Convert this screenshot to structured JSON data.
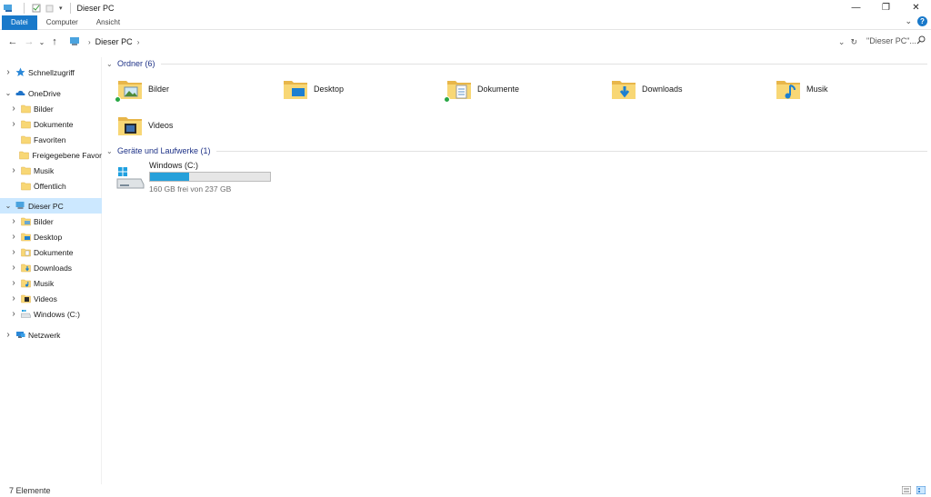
{
  "window": {
    "title": "Dieser PC",
    "controls": {
      "minimize": "—",
      "restore": "❐",
      "close": "✕"
    }
  },
  "ribbon": {
    "tabs": [
      {
        "label": "Datei",
        "active": true
      },
      {
        "label": "Computer",
        "active": false
      },
      {
        "label": "Ansicht",
        "active": false
      }
    ],
    "help": "?"
  },
  "nav": {
    "back": "←",
    "forward": "→",
    "recent": "⌄",
    "up": "↑",
    "address": {
      "location": "Dieser PC"
    },
    "search": {
      "placeholder": "\"Dieser PC\"..."
    }
  },
  "sidebar": {
    "items": [
      {
        "label": "Schnellzugriff",
        "icon": "star-icon",
        "level": 0,
        "expanded": false,
        "selected": false
      },
      {
        "label": "OneDrive",
        "icon": "cloud-icon",
        "level": 0,
        "expanded": true,
        "selected": false
      },
      {
        "label": "Bilder",
        "icon": "folder-icon",
        "level": 1,
        "expanded": false,
        "selected": false
      },
      {
        "label": "Dokumente",
        "icon": "folder-icon",
        "level": 1,
        "expanded": false,
        "selected": false
      },
      {
        "label": "Favoriten",
        "icon": "folder-icon",
        "level": 1,
        "expanded": null,
        "selected": false
      },
      {
        "label": "Freigegebene Favor",
        "icon": "folder-icon",
        "level": 1,
        "expanded": null,
        "selected": false
      },
      {
        "label": "Musik",
        "icon": "folder-icon",
        "level": 1,
        "expanded": false,
        "selected": false
      },
      {
        "label": "Öffentlich",
        "icon": "folder-icon",
        "level": 1,
        "expanded": null,
        "selected": false
      },
      {
        "label": "Dieser PC",
        "icon": "computer-icon",
        "level": 0,
        "expanded": true,
        "selected": true
      },
      {
        "label": "Bilder",
        "icon": "pictures-folder-icon",
        "level": 1,
        "expanded": false,
        "selected": false
      },
      {
        "label": "Desktop",
        "icon": "desktop-folder-icon",
        "level": 1,
        "expanded": false,
        "selected": false
      },
      {
        "label": "Dokumente",
        "icon": "documents-folder-icon",
        "level": 1,
        "expanded": false,
        "selected": false
      },
      {
        "label": "Downloads",
        "icon": "downloads-folder-icon",
        "level": 1,
        "expanded": false,
        "selected": false
      },
      {
        "label": "Musik",
        "icon": "music-folder-icon",
        "level": 1,
        "expanded": false,
        "selected": false
      },
      {
        "label": "Videos",
        "icon": "videos-folder-icon",
        "level": 1,
        "expanded": false,
        "selected": false
      },
      {
        "label": "Windows (C:)",
        "icon": "drive-icon",
        "level": 1,
        "expanded": false,
        "selected": false
      },
      {
        "label": "Netzwerk",
        "icon": "network-icon",
        "level": 0,
        "expanded": false,
        "selected": false
      }
    ]
  },
  "main": {
    "groups": [
      {
        "title": "Ordner (6)"
      },
      {
        "title": "Geräte und Laufwerke (1)"
      }
    ],
    "folders": [
      {
        "name": "Bilder",
        "icon": "pictures-folder-icon",
        "synced": true
      },
      {
        "name": "Desktop",
        "icon": "desktop-folder-icon",
        "synced": false
      },
      {
        "name": "Dokumente",
        "icon": "documents-folder-icon",
        "synced": true
      },
      {
        "name": "Downloads",
        "icon": "downloads-folder-icon",
        "synced": false
      },
      {
        "name": "Musik",
        "icon": "music-folder-icon",
        "synced": false
      },
      {
        "name": "Videos",
        "icon": "videos-folder-icon",
        "synced": false
      }
    ],
    "drives": [
      {
        "name": "Windows (C:)",
        "free_text": "160 GB frei von 237 GB",
        "used_fraction": 0.325
      }
    ]
  },
  "status": {
    "item_count": "7 Elemente"
  },
  "colors": {
    "accent": "#1979ca",
    "selection": "#cce8ff",
    "group_title": "#1e3287",
    "folder": "#f8d775",
    "drive_bar": "#26a0da"
  }
}
